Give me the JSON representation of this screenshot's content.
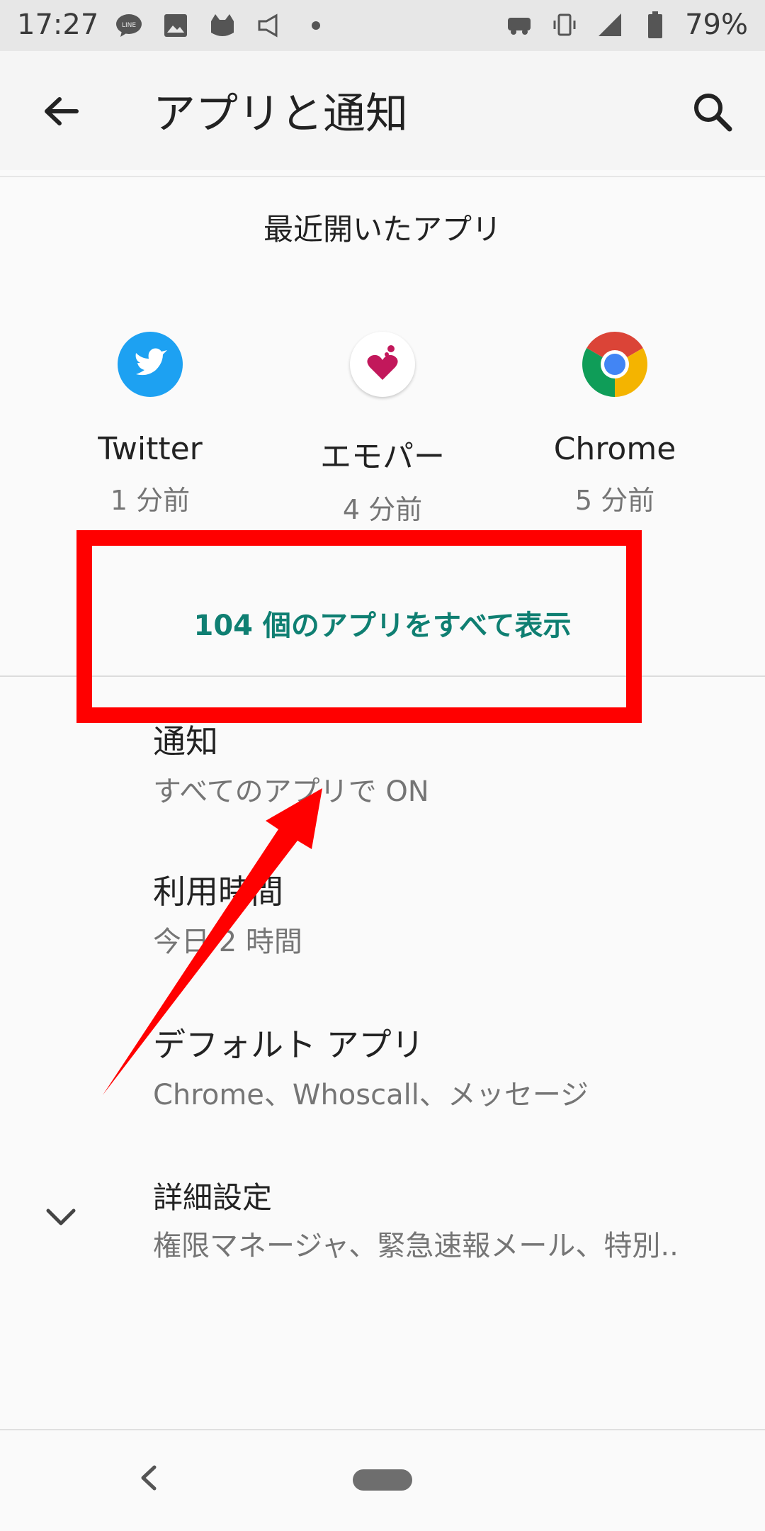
{
  "status_bar": {
    "time": "17:27",
    "battery": "79%",
    "notification_icons": [
      "line-icon",
      "image-icon",
      "cat-icon",
      "megaphone-icon",
      "dot-icon"
    ],
    "system_icons": [
      "car-icon",
      "vibrate-icon",
      "signal-icon",
      "battery-icon"
    ]
  },
  "app_bar": {
    "title": "アプリと通知"
  },
  "recent_apps": {
    "header": "最近開いたアプリ",
    "apps": [
      {
        "name": "Twitter",
        "time": "1 分前",
        "icon": "twitter-icon",
        "color": "#1da1f2"
      },
      {
        "name": "エモパー",
        "time": "4 分前",
        "icon": "heart-icon",
        "color": "#c2185b"
      },
      {
        "name": "Chrome",
        "time": "5 分前",
        "icon": "chrome-icon",
        "color": "#db4437"
      }
    ],
    "show_all": "104 個のアプリをすべて表示"
  },
  "settings": [
    {
      "title": "通知",
      "subtitle": "すべてのアプリで ON"
    },
    {
      "title": "利用時間",
      "subtitle": "今日 2 時間"
    },
    {
      "title": "デフォルト アプリ",
      "subtitle": "Chrome、Whoscall、メッセージ"
    },
    {
      "title": "詳細設定",
      "subtitle": "権限マネージャ、緊急速報メール、特別.."
    }
  ],
  "colors": {
    "accent": "#0f7f72",
    "annotation": "#ff0000"
  }
}
